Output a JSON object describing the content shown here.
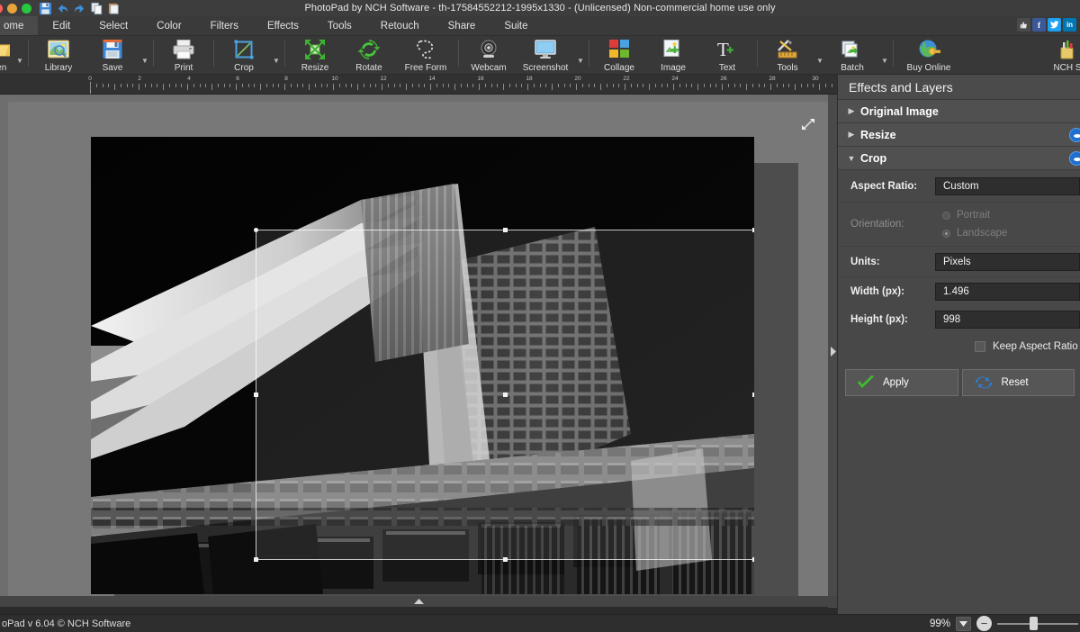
{
  "window": {
    "title": "PhotoPad by NCH Software - th-17584552212-1995x1330 - (Unlicensed) Non-commercial home use only",
    "traffic_lights": [
      "close",
      "minimize",
      "maximize"
    ]
  },
  "quick_access": [
    {
      "name": "save-icon",
      "label": "Save"
    },
    {
      "name": "undo-icon",
      "label": "Undo"
    },
    {
      "name": "redo-icon",
      "label": "Redo"
    },
    {
      "name": "copy-icon",
      "label": "Copy"
    },
    {
      "name": "paste-icon",
      "label": "Paste"
    }
  ],
  "menubar": {
    "items": [
      {
        "label": "ome",
        "active": true
      },
      {
        "label": "Edit",
        "active": false
      },
      {
        "label": "Select",
        "active": false
      },
      {
        "label": "Color",
        "active": false
      },
      {
        "label": "Filters",
        "active": false
      },
      {
        "label": "Effects",
        "active": false
      },
      {
        "label": "Tools",
        "active": false
      },
      {
        "label": "Retouch",
        "active": false
      },
      {
        "label": "Share",
        "active": false
      },
      {
        "label": "Suite",
        "active": false
      }
    ],
    "social": [
      {
        "name": "thumbs-up-icon",
        "glyph": "ὄD"
      },
      {
        "name": "facebook-icon",
        "glyph": "f"
      },
      {
        "name": "twitter-icon",
        "glyph": "t"
      },
      {
        "name": "linkedin-icon",
        "glyph": "in"
      }
    ]
  },
  "toolbar": {
    "items": [
      {
        "label": "pen",
        "icon": "folder-open-icon",
        "caret": true
      },
      {
        "label": "Library",
        "icon": "library-icon",
        "caret": false
      },
      {
        "label": "Save",
        "icon": "save-floppy-icon",
        "caret": true
      },
      {
        "label": "Print",
        "icon": "printer-icon",
        "caret": false
      },
      {
        "label": "Crop",
        "icon": "crop-icon",
        "caret": true
      },
      {
        "label": "Resize",
        "icon": "resize-icon",
        "caret": false
      },
      {
        "label": "Rotate",
        "icon": "rotate-icon",
        "caret": false
      },
      {
        "label": "Free Form",
        "icon": "free-form-icon",
        "caret": false
      },
      {
        "label": "Webcam",
        "icon": "webcam-icon",
        "caret": false
      },
      {
        "label": "Screenshot",
        "icon": "screenshot-icon",
        "caret": true
      },
      {
        "label": "Collage",
        "icon": "collage-icon",
        "caret": false
      },
      {
        "label": "Image",
        "icon": "image-add-icon",
        "caret": false
      },
      {
        "label": "Text",
        "icon": "text-add-icon",
        "caret": false
      },
      {
        "label": "Tools",
        "icon": "tools-icon",
        "caret": true
      },
      {
        "label": "Batch",
        "icon": "batch-icon",
        "caret": true
      },
      {
        "label": "Buy Online",
        "icon": "globe-key-icon",
        "caret": false
      },
      {
        "label": "NCH S",
        "icon": "nch-suite-icon",
        "caret": false
      }
    ]
  },
  "ruler": {
    "labels": [
      "0",
      "2",
      "4",
      "6",
      "8",
      "10",
      "12",
      "14",
      "16",
      "18",
      "20",
      "22",
      "24",
      "26",
      "28",
      "30"
    ]
  },
  "canvas": {
    "expand_icon": "expand-arrows-icon",
    "panel_handle_icon": "chevron-right-icon",
    "scroll_indicator_icon": "chevron-up-icon",
    "image_alt": "black and white upward view of a building facade"
  },
  "panel": {
    "title": "Effects and Layers",
    "layers": [
      {
        "name": "Original Image",
        "expanded": false,
        "has_visibility": false
      },
      {
        "name": "Resize",
        "expanded": false,
        "has_visibility": true
      },
      {
        "name": "Crop",
        "expanded": true,
        "has_visibility": true
      }
    ],
    "crop": {
      "aspect_ratio_label": "Aspect Ratio:",
      "aspect_ratio_value": "Custom",
      "orientation_label": "Orientation:",
      "orientation_options": [
        {
          "label": "Portrait",
          "selected": false
        },
        {
          "label": "Landscape",
          "selected": true
        }
      ],
      "units_label": "Units:",
      "units_value": "Pixels",
      "width_label": "Width (px):",
      "width_value": "1.496",
      "height_label": "Height (px):",
      "height_value": "998",
      "keep_aspect_label": "Keep Aspect Ratio",
      "keep_aspect_checked": false,
      "apply_label": "Apply",
      "reset_label": "Reset"
    }
  },
  "statusbar": {
    "text": "oPad v 6.04 © NCH Software",
    "zoom_value": "99%",
    "zoom_dropdown_icon": "chevron-down-icon",
    "zoom_minus_icon": "minus-circle-icon"
  },
  "colors": {
    "accent_blue": "#1f6fd0",
    "apply_green": "#3fbc2f",
    "reset_blue": "#2a7fd4",
    "panel_bg": "#484848",
    "chrome_bg": "#383838"
  }
}
